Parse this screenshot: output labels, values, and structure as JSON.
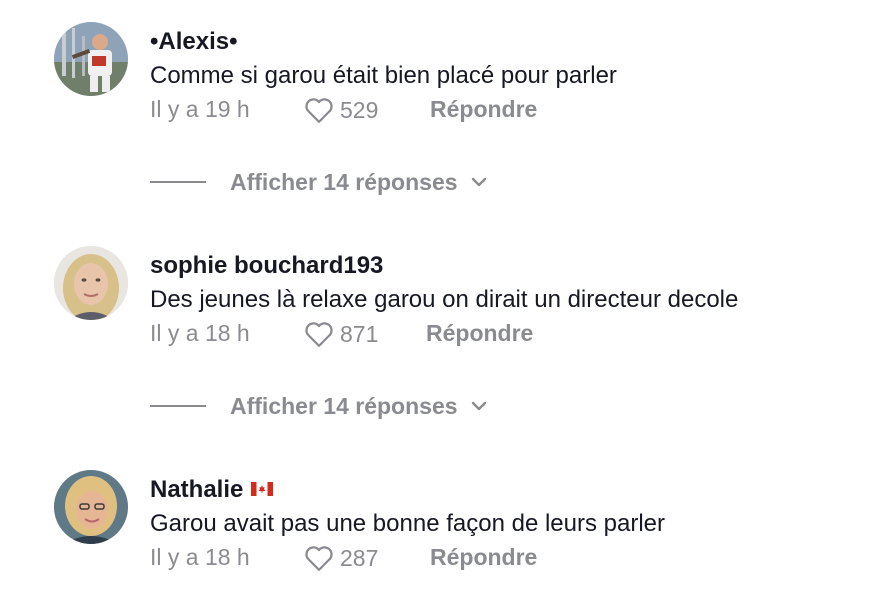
{
  "comments": [
    {
      "username": "•Alexis•",
      "text": "Comme si garou était bien placé pour parler",
      "time": "Il y a 19 h",
      "likes": "529",
      "reply_label": "Répondre",
      "replies_label": "Afficher 14 réponses"
    },
    {
      "username": "sophie bouchard193",
      "text": "Des jeunes là relaxe garou on dirait un directeur decole",
      "time": "Il y a 18 h",
      "likes": "871",
      "reply_label": "Répondre",
      "replies_label": "Afficher 14 réponses"
    },
    {
      "username": "Nathalie",
      "flag": "canada-flag-icon",
      "text": "Garou avait pas une bonne façon de leurs parler",
      "time": "Il y a 18 h",
      "likes": "287",
      "reply_label": "Répondre"
    }
  ],
  "colors": {
    "text": "#161823",
    "muted": "#8a8b91",
    "background": "#ffffff"
  }
}
